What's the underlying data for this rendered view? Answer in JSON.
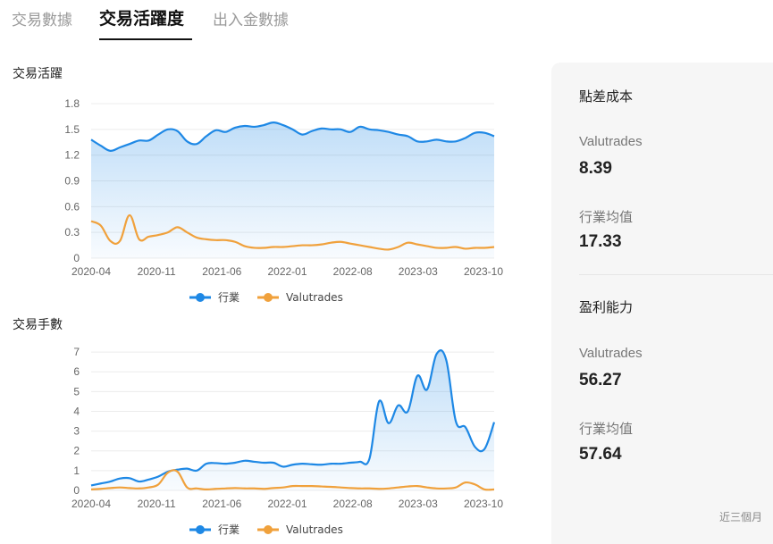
{
  "tabs": [
    {
      "label": "交易數據",
      "active": false
    },
    {
      "label": "交易活躍度",
      "active": true
    },
    {
      "label": "出入金數據",
      "active": false
    }
  ],
  "colors": {
    "industry": "#1e88e5",
    "valutrades": "#f0a13c"
  },
  "legend": {
    "industry": "行業",
    "valutrades": "Valutrades"
  },
  "chart_data": [
    {
      "type": "area",
      "title": "交易活躍",
      "x_ticks": [
        "2020-04",
        "2020-11",
        "2021-06",
        "2022-01",
        "2022-08",
        "2023-03",
        "2023-10"
      ],
      "y_ticks": [
        "0",
        "0.3",
        "0.6",
        "0.9",
        "1.2",
        "1.5",
        "1.8"
      ],
      "ylim": [
        0,
        1.8
      ],
      "x": [
        "2020-04",
        "2020-05",
        "2020-06",
        "2020-07",
        "2020-08",
        "2020-09",
        "2020-10",
        "2020-11",
        "2020-12",
        "2021-01",
        "2021-02",
        "2021-03",
        "2021-04",
        "2021-05",
        "2021-06",
        "2021-07",
        "2021-08",
        "2021-09",
        "2021-10",
        "2021-11",
        "2021-12",
        "2022-01",
        "2022-02",
        "2022-03",
        "2022-04",
        "2022-05",
        "2022-06",
        "2022-07",
        "2022-08",
        "2022-09",
        "2022-10",
        "2022-11",
        "2022-12",
        "2023-01",
        "2023-02",
        "2023-03",
        "2023-04",
        "2023-05",
        "2023-06",
        "2023-07",
        "2023-08",
        "2023-09",
        "2023-10"
      ],
      "series": [
        {
          "name": "行業",
          "values": [
            1.38,
            1.31,
            1.25,
            1.29,
            1.33,
            1.37,
            1.37,
            1.44,
            1.5,
            1.48,
            1.36,
            1.33,
            1.42,
            1.49,
            1.47,
            1.52,
            1.54,
            1.53,
            1.55,
            1.58,
            1.55,
            1.5,
            1.44,
            1.48,
            1.51,
            1.5,
            1.5,
            1.47,
            1.53,
            1.5,
            1.49,
            1.47,
            1.44,
            1.42,
            1.36,
            1.36,
            1.38,
            1.36,
            1.36,
            1.4,
            1.46,
            1.46,
            1.42
          ]
        },
        {
          "name": "Valutrades",
          "values": [
            0.43,
            0.38,
            0.2,
            0.2,
            0.5,
            0.22,
            0.25,
            0.27,
            0.3,
            0.36,
            0.3,
            0.24,
            0.22,
            0.21,
            0.21,
            0.19,
            0.14,
            0.12,
            0.12,
            0.13,
            0.13,
            0.14,
            0.15,
            0.15,
            0.16,
            0.18,
            0.19,
            0.17,
            0.15,
            0.13,
            0.11,
            0.1,
            0.13,
            0.18,
            0.16,
            0.14,
            0.12,
            0.12,
            0.13,
            0.11,
            0.12,
            0.12,
            0.13
          ]
        }
      ]
    },
    {
      "type": "area",
      "title": "交易手數",
      "x_ticks": [
        "2020-04",
        "2020-11",
        "2021-06",
        "2022-01",
        "2022-08",
        "2023-03",
        "2023-10"
      ],
      "y_ticks": [
        "0",
        "1",
        "2",
        "3",
        "4",
        "5",
        "6",
        "7"
      ],
      "ylim": [
        0,
        7.5
      ],
      "x": [
        "2020-04",
        "2020-05",
        "2020-06",
        "2020-07",
        "2020-08",
        "2020-09",
        "2020-10",
        "2020-11",
        "2020-12",
        "2021-01",
        "2021-02",
        "2021-03",
        "2021-04",
        "2021-05",
        "2021-06",
        "2021-07",
        "2021-08",
        "2021-09",
        "2021-10",
        "2021-11",
        "2021-12",
        "2022-01",
        "2022-02",
        "2022-03",
        "2022-04",
        "2022-05",
        "2022-06",
        "2022-07",
        "2022-08",
        "2022-09",
        "2022-10",
        "2022-11",
        "2022-12",
        "2023-01",
        "2023-02",
        "2023-03",
        "2023-04",
        "2023-05",
        "2023-06",
        "2023-07",
        "2023-08",
        "2023-09",
        "2023-10"
      ],
      "series": [
        {
          "name": "行業",
          "values": [
            0.25,
            0.35,
            0.45,
            0.6,
            0.62,
            0.45,
            0.55,
            0.7,
            0.95,
            1.05,
            1.1,
            1.0,
            1.35,
            1.38,
            1.35,
            1.4,
            1.5,
            1.45,
            1.4,
            1.4,
            1.2,
            1.3,
            1.35,
            1.32,
            1.3,
            1.35,
            1.35,
            1.4,
            1.45,
            1.6,
            4.5,
            3.4,
            4.3,
            4.0,
            5.8,
            5.1,
            6.9,
            6.6,
            3.5,
            3.2,
            2.2,
            2.1,
            3.45
          ]
        },
        {
          "name": "Valutrades",
          "values": [
            0.05,
            0.08,
            0.12,
            0.15,
            0.12,
            0.1,
            0.15,
            0.3,
            0.9,
            0.95,
            0.15,
            0.1,
            0.05,
            0.08,
            0.1,
            0.12,
            0.1,
            0.1,
            0.08,
            0.12,
            0.15,
            0.22,
            0.22,
            0.22,
            0.2,
            0.18,
            0.15,
            0.12,
            0.1,
            0.1,
            0.08,
            0.1,
            0.15,
            0.2,
            0.22,
            0.15,
            0.1,
            0.1,
            0.15,
            0.4,
            0.3,
            0.05,
            0.05
          ]
        }
      ]
    }
  ],
  "side_panel": {
    "spread": {
      "title": "點差成本",
      "broker_label": "Valutrades",
      "broker_value": "8.39",
      "avg_label": "行業均值",
      "avg_value": "17.33"
    },
    "profit": {
      "title": "盈利能力",
      "broker_label": "Valutrades",
      "broker_value": "56.27",
      "avg_label": "行業均值",
      "avg_value": "57.64"
    },
    "footnote": "近三個月"
  }
}
